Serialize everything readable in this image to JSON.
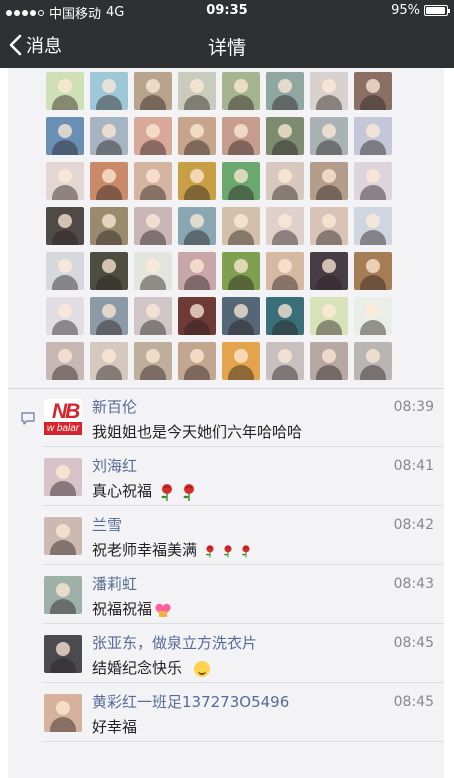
{
  "status_bar": {
    "carrier": "中国移动",
    "network": "4G",
    "time": "09:35",
    "battery": "95%",
    "battery_level": 0.95
  },
  "nav": {
    "back_label": "消息",
    "title": "详情"
  },
  "likes": {
    "avatar_colors": [
      "#cfe0b7",
      "#9ec7d8",
      "#b8a38c",
      "#c9cbbc",
      "#a6b48f",
      "#8fa7a0",
      "#d9d1cd",
      "#8c6f64",
      "#6a8fb4",
      "#a7b4c2",
      "#d8a899",
      "#c6a58c",
      "#c79d8f",
      "#7d8b70",
      "#a9b3b6",
      "#c4c7d8",
      "#e3d6d3",
      "#c88a67",
      "#d6b4a2",
      "#c7a046",
      "#6aa86e",
      "#d7c9c0",
      "#b59d8b",
      "#ddd4dd",
      "#4f4a45",
      "#9a8b6f",
      "#c9b7b8",
      "#89a7b2",
      "#d3c0aa",
      "#e0d0cb",
      "#d9c3b9",
      "#cfd6e1",
      "#d5d9de",
      "#4e4d42",
      "#e2e6df",
      "#c8a7a8",
      "#7fa04f",
      "#d5b9a3",
      "#473d45",
      "#a67e55",
      "#e1dde5",
      "#8c99a6",
      "#d0c6c7",
      "#6e3a37",
      "#556677",
      "#3a6e79",
      "#d8e2b8",
      "#e9efe6",
      "#c7b8b5",
      "#d4c8bf",
      "#bfae9c",
      "#c2a68f",
      "#e4a44e",
      "#c7c0bf",
      "#b7a8a2",
      "#b8b5b3"
    ]
  },
  "comments": [
    {
      "name": "新百伦",
      "time": "08:39",
      "text": "我姐姐也是今天她们六年哈哈哈",
      "avatar": "logo",
      "logo_top": "NB",
      "logo_bottom": "w balar",
      "emoji": ""
    },
    {
      "name": "刘海红",
      "time": "08:41",
      "text": "真心祝福",
      "avatar_color": "#d9c2c7",
      "emoji": "roses"
    },
    {
      "name": "兰雪",
      "time": "08:42",
      "text": "祝老师幸福美满",
      "avatar_color": "#cdb9b2",
      "emoji": "small-roses"
    },
    {
      "name": "潘莉虹",
      "time": "08:43",
      "text": "祝福祝福",
      "avatar_color": "#9fb0a8",
      "emoji": "heart-gift"
    },
    {
      "name": "张亚东，做泉立方洗衣片",
      "time": "08:45",
      "text": "结婚纪念快乐",
      "avatar_color": "#4a4a4f",
      "emoji": "smile"
    },
    {
      "name": "黄彩红一班足137273O5496",
      "time": "08:45",
      "text": "好幸福",
      "avatar_color": "#d6b29c",
      "emoji": ""
    }
  ]
}
